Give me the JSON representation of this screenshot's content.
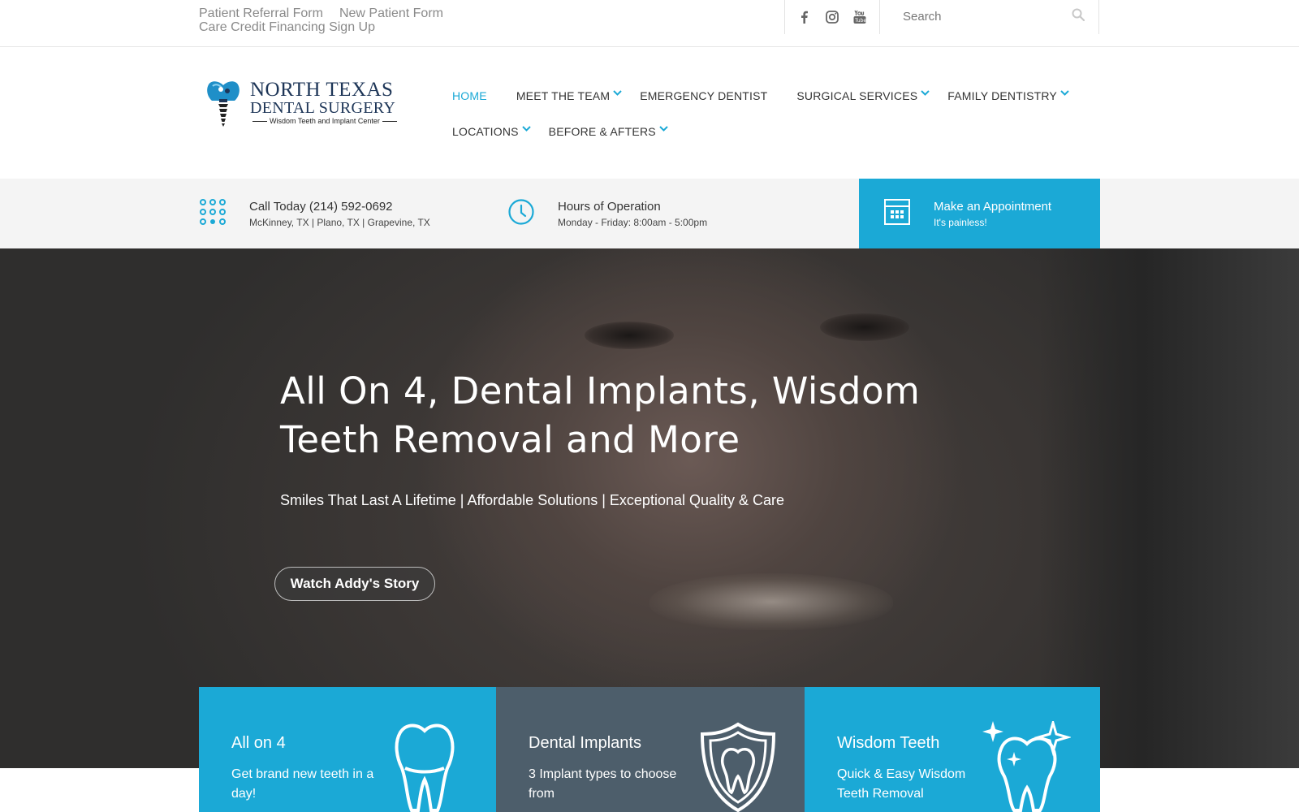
{
  "topbar": {
    "links": [
      "Patient Referral Form",
      "New Patient Form",
      "Care Credit Financing Sign Up"
    ],
    "social": [
      "facebook-icon",
      "instagram-icon",
      "youtube-icon"
    ],
    "search_placeholder": "Search"
  },
  "logo": {
    "line1": "NORTH TEXAS",
    "line2": "DENTAL SURGERY",
    "tagline": "Wisdom Teeth and Implant Center"
  },
  "nav": {
    "items": [
      {
        "label": "HOME",
        "active": true,
        "dropdown": false
      },
      {
        "label": "MEET THE TEAM",
        "active": false,
        "dropdown": true
      },
      {
        "label": "EMERGENCY DENTIST",
        "active": false,
        "dropdown": false
      },
      {
        "label": "SURGICAL SERVICES",
        "active": false,
        "dropdown": true
      },
      {
        "label": "FAMILY DENTISTRY",
        "active": false,
        "dropdown": true
      },
      {
        "label": "LOCATIONS",
        "active": false,
        "dropdown": true
      },
      {
        "label": "BEFORE & AFTERS",
        "active": false,
        "dropdown": true
      }
    ]
  },
  "info": {
    "call": {
      "title": "Call Today (214) 592-0692",
      "sub": "McKinney, TX  |  Plano, TX  |  Grapevine, TX"
    },
    "hours": {
      "title": "Hours of Operation",
      "sub": "Monday - Friday: 8:00am - 5:00pm"
    },
    "appointment": {
      "title": "Make an Appointment",
      "sub": "It's painless!"
    }
  },
  "hero": {
    "headline": "All On 4, Dental Implants, Wisdom Teeth Removal and More",
    "subline": "Smiles That Last A Lifetime | Affordable Solutions | Exceptional Quality & Care",
    "cta": "Watch Addy's Story"
  },
  "cards": [
    {
      "title": "All on 4",
      "desc": "Get brand new teeth in a day!",
      "icon": "tooth-icon"
    },
    {
      "title": "Dental Implants",
      "desc": "3 Implant types to choose from",
      "icon": "shield-tooth-icon"
    },
    {
      "title": "Wisdom Teeth",
      "desc": "Quick & Easy Wisdom Teeth Removal",
      "icon": "sparkle-tooth-icon"
    }
  ],
  "colors": {
    "accent": "#1ba9d6",
    "slate": "#4d5e6b",
    "logo_navy": "#1d3557"
  }
}
